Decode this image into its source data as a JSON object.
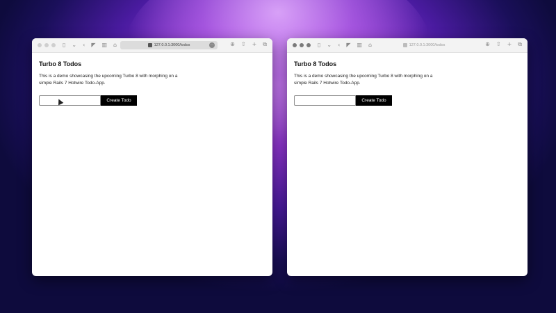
{
  "windows": [
    {
      "address": "127.0.0.1:3000/todos",
      "title": "Turbo 8 Todos",
      "description": "This is a demo showcasing the upcoming Turbo 8 with morphing on a simple Rails 7 Hotwire Todo-App.",
      "input_value": "",
      "button_label": "Create Todo"
    },
    {
      "address": "127.0.0.1:3000/todos",
      "title": "Turbo 8 Todos",
      "description": "This is a demo showcasing the upcoming Turbo 8 with morphing on a simple Rails 7 Hotwire Todo-App.",
      "input_value": "",
      "button_label": "Create Todo"
    }
  ],
  "icons": {
    "sidebar": "sidebar-icon",
    "back": "chevron-left-icon",
    "shield": "shield-icon",
    "reader": "reader-icon",
    "download": "download-icon",
    "share": "share-icon",
    "new_tab": "plus-icon",
    "tabs": "tabs-icon"
  }
}
